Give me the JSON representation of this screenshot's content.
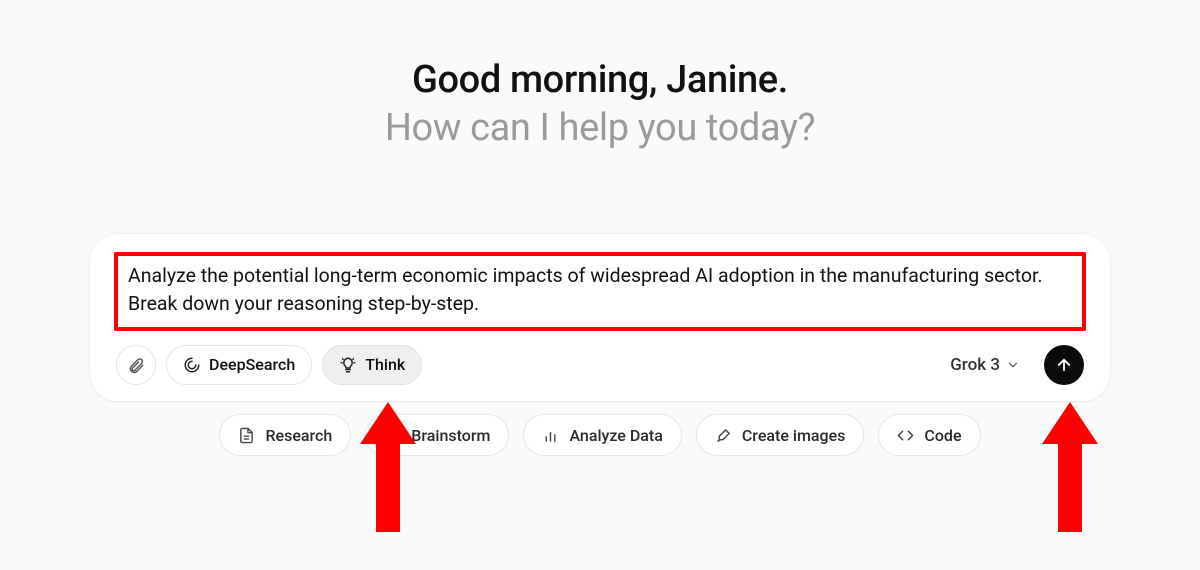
{
  "greeting": {
    "line1": "Good morning, Janine.",
    "line2": "How can I help you today?"
  },
  "prompt": {
    "text": "Analyze the potential long-term economic impacts of widespread AI adoption in the manufacturing sector. Break down your reasoning step-by-step."
  },
  "toolbar": {
    "deepsearch_label": "DeepSearch",
    "think_label": "Think",
    "model_label": "Grok 3"
  },
  "suggestions": [
    {
      "icon": "document",
      "label": "Research"
    },
    {
      "icon": "bolt",
      "label": "Brainstorm"
    },
    {
      "icon": "bars",
      "label": "Analyze Data"
    },
    {
      "icon": "brush",
      "label": "Create images"
    },
    {
      "icon": "code",
      "label": "Code"
    }
  ],
  "annotation": {
    "color": "#ff0000"
  }
}
